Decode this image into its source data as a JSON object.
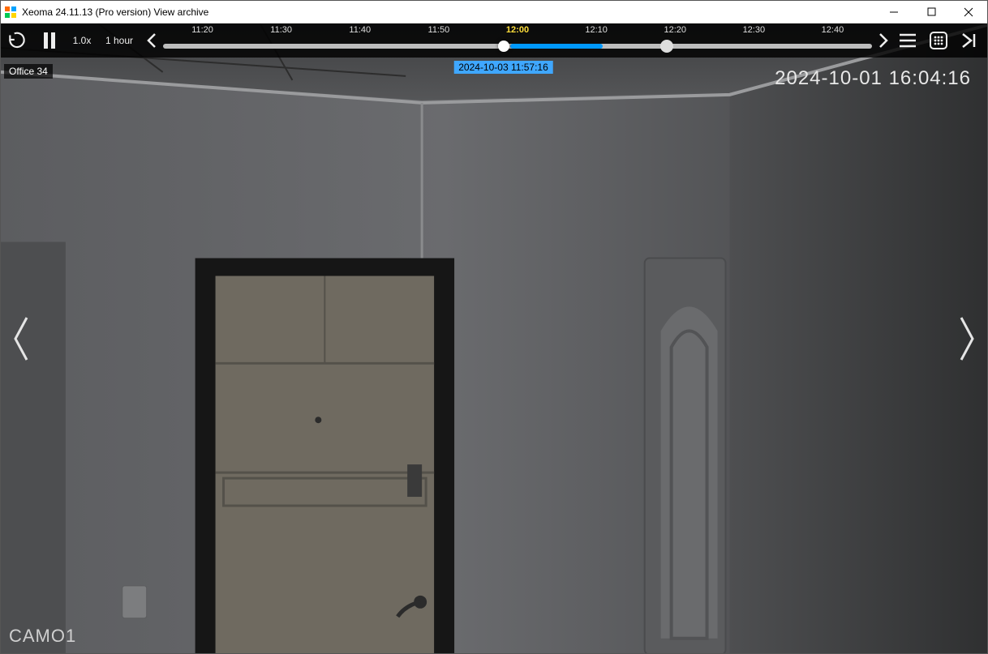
{
  "titlebar": {
    "title": "Xeoma 24.11.13 (Pro version) View archive"
  },
  "toolbar": {
    "speed_label": "1.0x",
    "range_label": "1 hour"
  },
  "timeline": {
    "ticks": [
      "11:20",
      "11:30",
      "11:40",
      "11:50",
      "12:00",
      "12:10",
      "12:20",
      "12:30",
      "12:40"
    ],
    "current_tick": "12:00",
    "tooltip": "2024-10-03 11:57:16",
    "playhead_pct": 48,
    "fill_start_pct": 49,
    "fill_end_pct": 62,
    "endmark_pct": 71,
    "tooltip_pct": 48
  },
  "overlay": {
    "camera_tag": "Office 34",
    "timestamp": "2024-10-01 16:04:16",
    "camera_name": "CAMO1"
  }
}
